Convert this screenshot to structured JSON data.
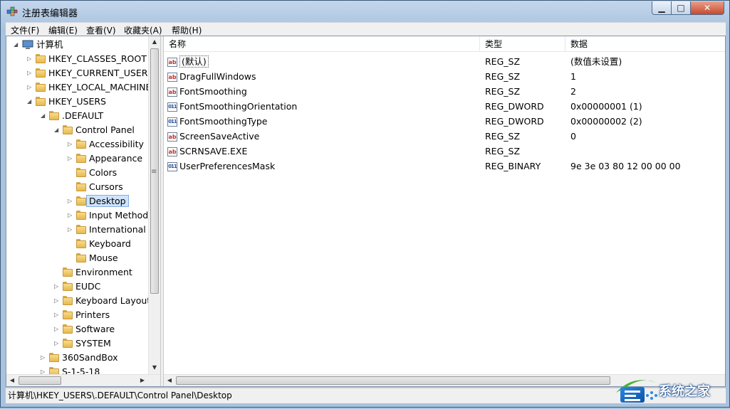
{
  "window": {
    "title": "注册表编辑器",
    "controls": {
      "minimize": "▁",
      "maximize": "□",
      "close": "✕"
    }
  },
  "menu": [
    "文件(F)",
    "编辑(E)",
    "查看(V)",
    "收藏夹(A)",
    "帮助(H)"
  ],
  "tree": [
    {
      "label": "计算机",
      "level": 0,
      "expander": "open",
      "icon": "computer-icon"
    },
    {
      "label": "HKEY_CLASSES_ROOT",
      "level": 1,
      "expander": "closed"
    },
    {
      "label": "HKEY_CURRENT_USER",
      "level": 1,
      "expander": "closed"
    },
    {
      "label": "HKEY_LOCAL_MACHINE",
      "level": 1,
      "expander": "closed"
    },
    {
      "label": "HKEY_USERS",
      "level": 1,
      "expander": "open"
    },
    {
      "label": ".DEFAULT",
      "level": 2,
      "expander": "open"
    },
    {
      "label": "Control Panel",
      "level": 3,
      "expander": "open"
    },
    {
      "label": "Accessibility",
      "level": 4,
      "expander": "closed"
    },
    {
      "label": "Appearance",
      "level": 4,
      "expander": "closed"
    },
    {
      "label": "Colors",
      "level": 4,
      "expander": "none"
    },
    {
      "label": "Cursors",
      "level": 4,
      "expander": "none"
    },
    {
      "label": "Desktop",
      "level": 4,
      "expander": "closed",
      "selected": true
    },
    {
      "label": "Input Method",
      "level": 4,
      "expander": "closed"
    },
    {
      "label": "International",
      "level": 4,
      "expander": "closed"
    },
    {
      "label": "Keyboard",
      "level": 4,
      "expander": "none"
    },
    {
      "label": "Mouse",
      "level": 4,
      "expander": "none"
    },
    {
      "label": "Environment",
      "level": 3,
      "expander": "none"
    },
    {
      "label": "EUDC",
      "level": 3,
      "expander": "closed"
    },
    {
      "label": "Keyboard Layout",
      "level": 3,
      "expander": "closed"
    },
    {
      "label": "Printers",
      "level": 3,
      "expander": "closed"
    },
    {
      "label": "Software",
      "level": 3,
      "expander": "closed"
    },
    {
      "label": "SYSTEM",
      "level": 3,
      "expander": "closed"
    },
    {
      "label": "360SandBox",
      "level": 2,
      "expander": "closed"
    },
    {
      "label": "S-1-5-18",
      "level": 2,
      "expander": "closed"
    }
  ],
  "columns": {
    "name": "名称",
    "type": "类型",
    "data": "数据"
  },
  "values": [
    {
      "name": "(默认)",
      "type": "REG_SZ",
      "data": "(数值未设置)",
      "icon": "sz",
      "is_default": true
    },
    {
      "name": "DragFullWindows",
      "type": "REG_SZ",
      "data": "1",
      "icon": "sz"
    },
    {
      "name": "FontSmoothing",
      "type": "REG_SZ",
      "data": "2",
      "icon": "sz"
    },
    {
      "name": "FontSmoothingOrientation",
      "type": "REG_DWORD",
      "data": "0x00000001 (1)",
      "icon": "bin"
    },
    {
      "name": "FontSmoothingType",
      "type": "REG_DWORD",
      "data": "0x00000002 (2)",
      "icon": "bin"
    },
    {
      "name": "ScreenSaveActive",
      "type": "REG_SZ",
      "data": "0",
      "icon": "sz"
    },
    {
      "name": "SCRNSAVE.EXE",
      "type": "REG_SZ",
      "data": "",
      "icon": "sz"
    },
    {
      "name": "UserPreferencesMask",
      "type": "REG_BINARY",
      "data": "9e 3e 03 80 12 00 00 00",
      "icon": "bin"
    }
  ],
  "icon_glyphs": {
    "sz": "ab",
    "bin": "011"
  },
  "status": "计算机\\HKEY_USERS\\.DEFAULT\\Control Panel\\Desktop",
  "watermark": "系统之家",
  "colors": {
    "selection": "#cfe3fb",
    "folder": "#e6b94f",
    "titlebar": "#c4d6ec"
  }
}
